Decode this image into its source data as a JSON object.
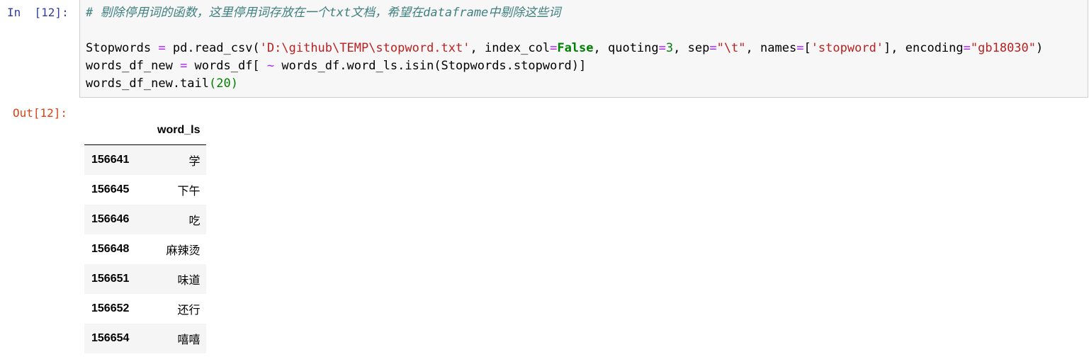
{
  "input_prompt": "In  [12]:",
  "output_prompt": "Out[12]:",
  "code": {
    "comment": "# 剔除停用词的函数，这里停用词存放在一个txt文档，希望在dataframe中剔除这些词",
    "line2": {
      "p1": "Stopwords ",
      "eq1": "=",
      "p2": " pd.read_csv(",
      "path": "'D:\\github\\TEMP\\stopword.txt'",
      "p3": ", index_col",
      "eq2": "=",
      "false_kw": "False",
      "p4": ", quoting",
      "eq3": "=",
      "three": "3",
      "p5": ", sep",
      "eq4": "=",
      "sep_val": "\"\\t\"",
      "p6": ", names",
      "eq5": "=",
      "p7": "[",
      "names_val": "'stopword'",
      "p8": "], encoding",
      "eq6": "=",
      "enc_val": "\"gb18030\"",
      "p9": ")"
    },
    "line3": {
      "p1": "words_df_new ",
      "eq": "=",
      "p2": " words_df[ ",
      "tilde": "~",
      "p3": " words_df.word_ls.isin(Stopwords.stopword)]"
    },
    "line4": {
      "p1": "words_df_new.tail",
      "arg": "(20)"
    }
  },
  "table": {
    "column": "word_ls",
    "rows": [
      {
        "index": "156641",
        "value": "学"
      },
      {
        "index": "156645",
        "value": "下午"
      },
      {
        "index": "156646",
        "value": "吃"
      },
      {
        "index": "156648",
        "value": "麻辣烫"
      },
      {
        "index": "156651",
        "value": "味道"
      },
      {
        "index": "156652",
        "value": "还行"
      },
      {
        "index": "156654",
        "value": "嘻嘻"
      }
    ]
  }
}
